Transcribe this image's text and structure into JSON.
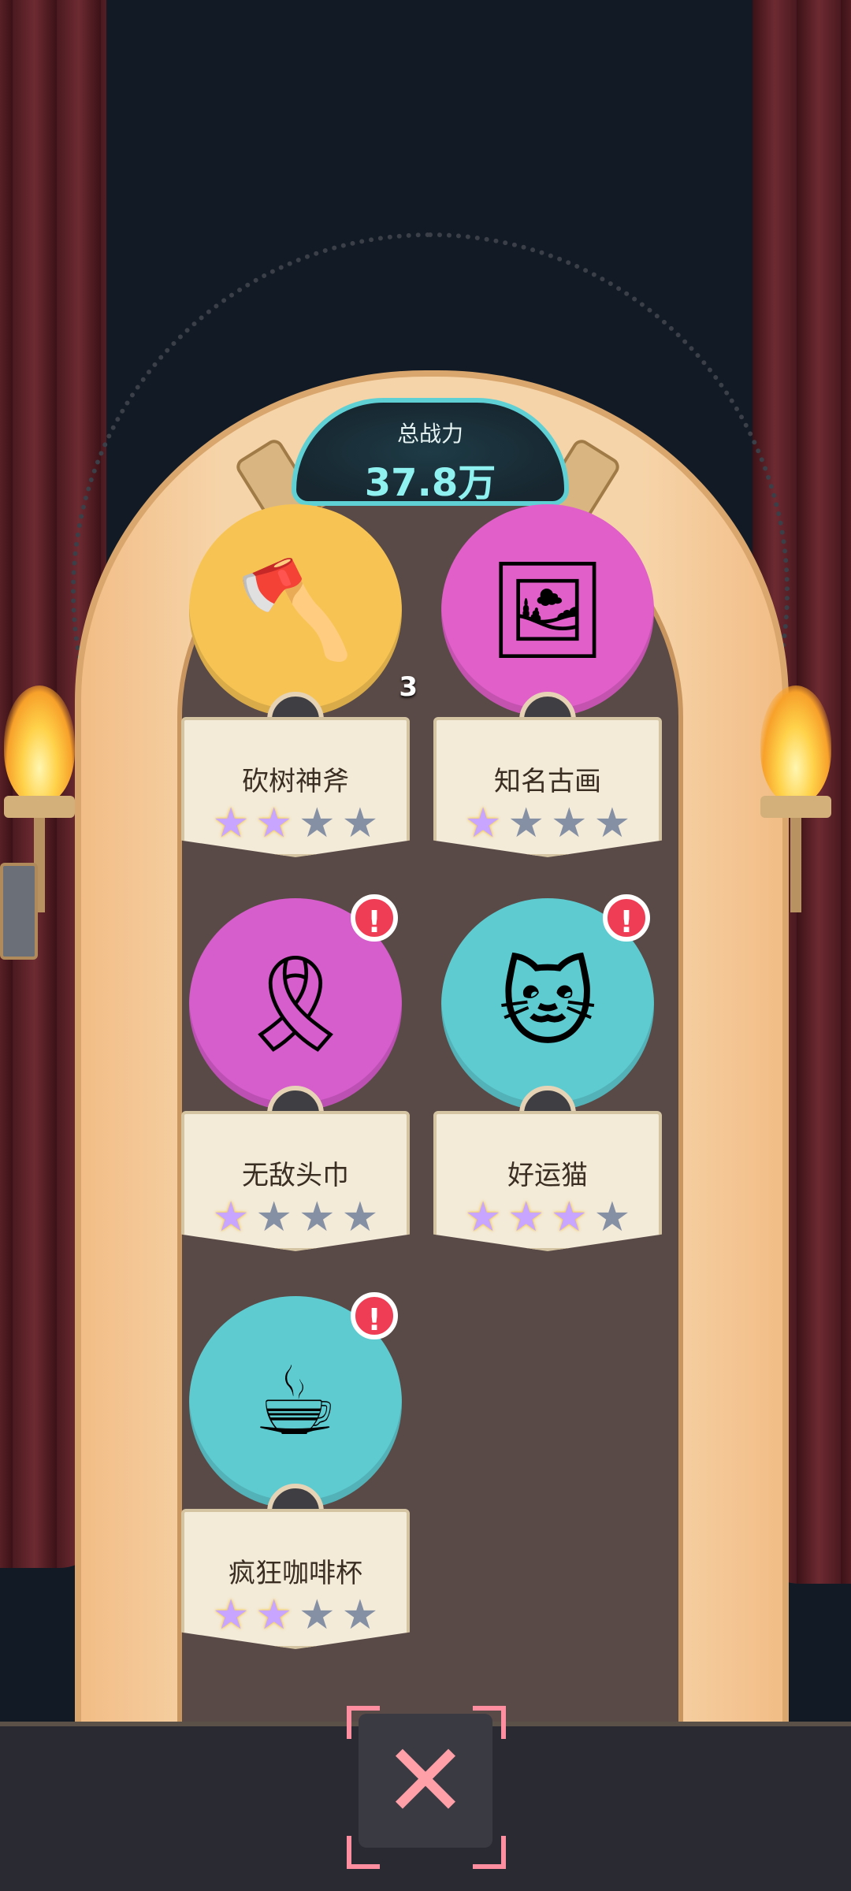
{
  "header": {
    "power_label": "总战力",
    "power_value": "37.8万"
  },
  "items": [
    {
      "name": "砍树神斧",
      "icon": "axe-icon",
      "glyph": "🪓",
      "circle_color": "#f7c454",
      "stars_on": 2,
      "stars_total": 4,
      "alert": false,
      "count": "3"
    },
    {
      "name": "知名古画",
      "icon": "tiger-painting-icon",
      "glyph": "🖼",
      "circle_color": "#e05fc9",
      "stars_on": 1,
      "stars_total": 4,
      "alert": false,
      "count": ""
    },
    {
      "name": "无敌头巾",
      "icon": "victory-headband-icon",
      "glyph": "🎗",
      "circle_color": "#d65dcc",
      "stars_on": 1,
      "stars_total": 4,
      "alert": true,
      "count": ""
    },
    {
      "name": "好运猫",
      "icon": "lucky-cat-icon",
      "glyph": "🐱",
      "circle_color": "#5ecbd1",
      "stars_on": 3,
      "stars_total": 4,
      "alert": true,
      "count": ""
    },
    {
      "name": "疯狂咖啡杯",
      "icon": "coffee-cup-icon",
      "glyph": "☕",
      "circle_color": "#5ecbd1",
      "stars_on": 2,
      "stars_total": 4,
      "alert": true,
      "count": ""
    }
  ],
  "alert_symbol": "!",
  "star_symbol": "★",
  "close_symbol": "✕"
}
